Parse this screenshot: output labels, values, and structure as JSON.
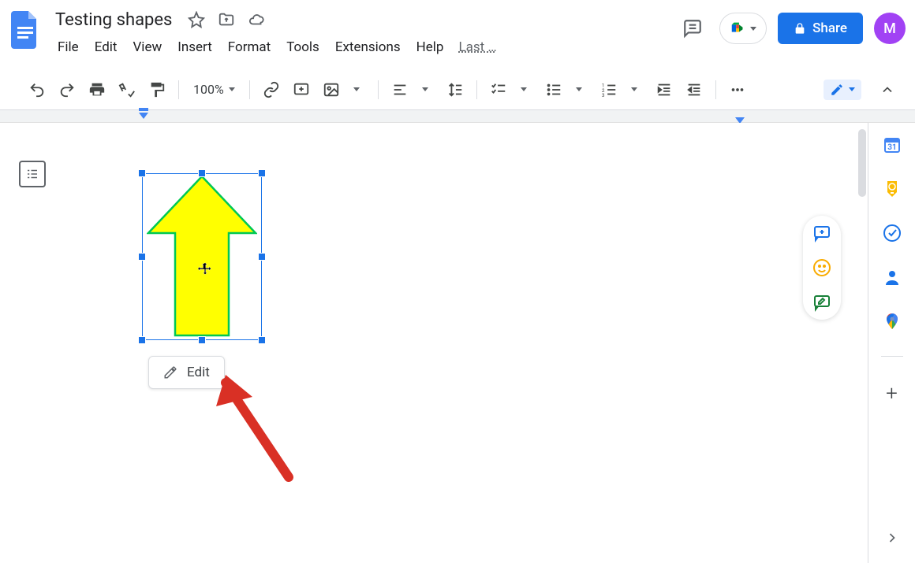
{
  "document": {
    "title": "Testing shapes"
  },
  "menus": [
    "File",
    "Edit",
    "View",
    "Insert",
    "Format",
    "Tools",
    "Extensions",
    "Help"
  ],
  "last_edit": "Last …",
  "toolbar": {
    "zoom": "100%"
  },
  "share": {
    "label": "Share"
  },
  "avatar": {
    "initial": "M"
  },
  "edit_chip": {
    "label": "Edit"
  },
  "shape": {
    "type": "up-arrow",
    "fill": "#ffff00",
    "stroke": "#00c853",
    "selected": true
  },
  "colors": {
    "primary": "#1a73e8",
    "accent_purple": "#a142f4"
  }
}
